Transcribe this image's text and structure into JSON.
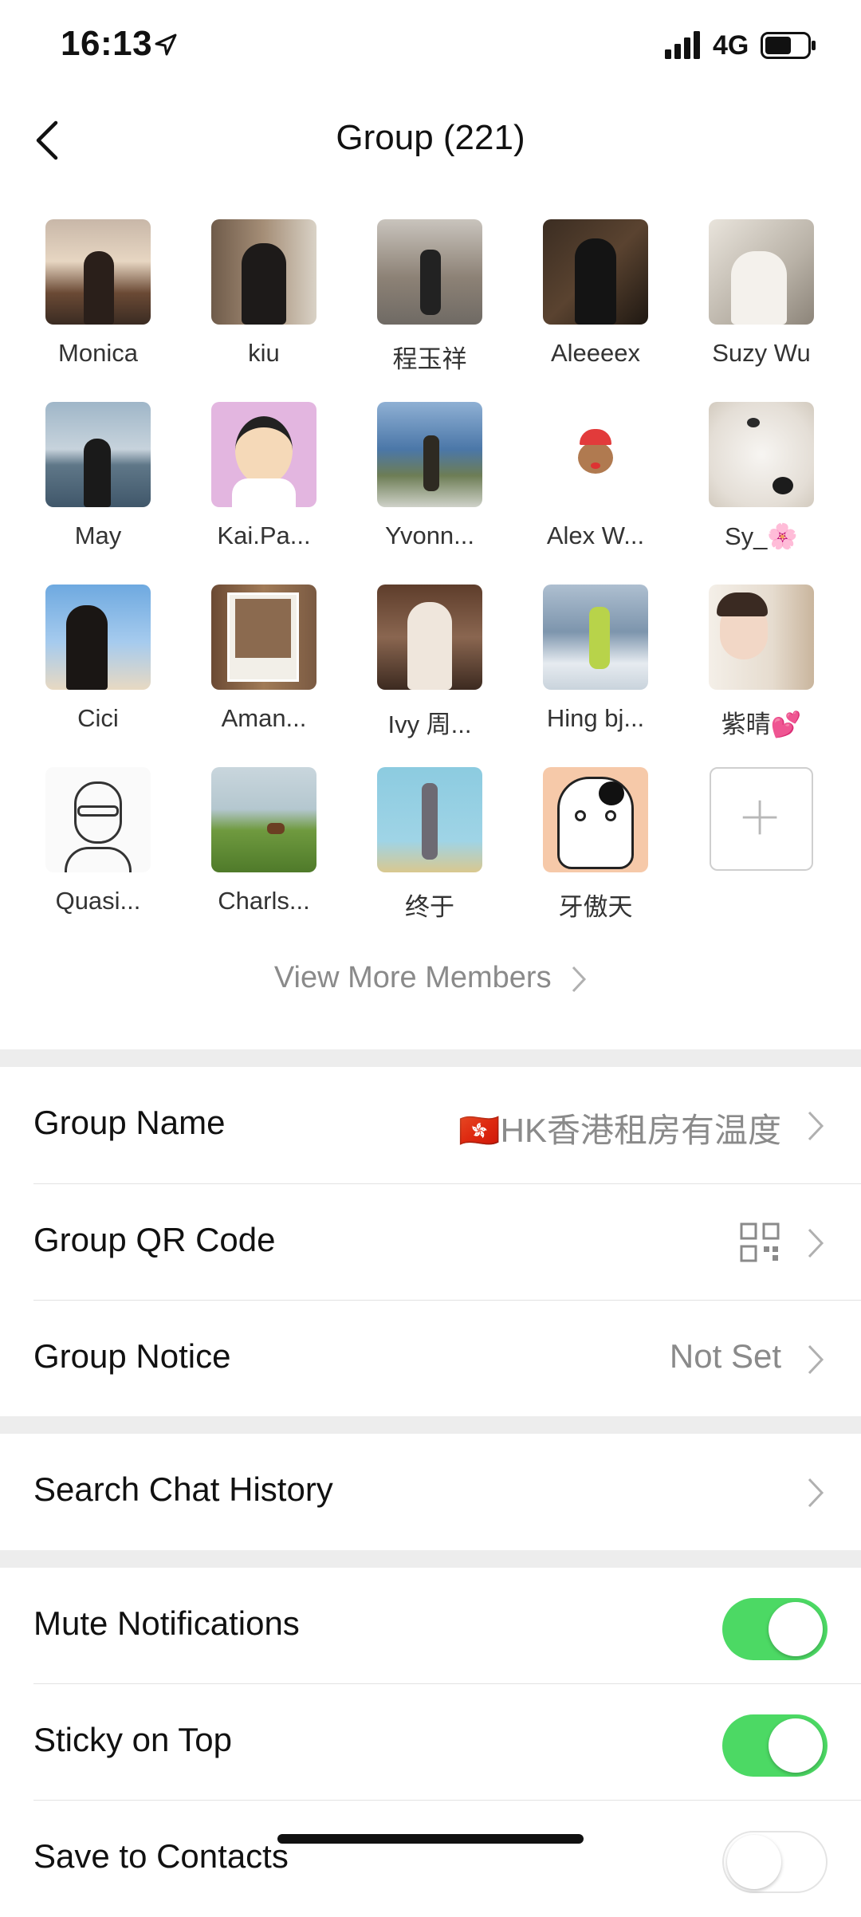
{
  "status": {
    "time": "16:13",
    "network": "4G"
  },
  "nav": {
    "title": "Group (221)"
  },
  "members": [
    {
      "name": "Monica"
    },
    {
      "name": "kiu"
    },
    {
      "name": "程玉祥"
    },
    {
      "name": "Aleeeex"
    },
    {
      "name": "Suzy Wu"
    },
    {
      "name": "May"
    },
    {
      "name": "Kai.Pa..."
    },
    {
      "name": "Yvonn..."
    },
    {
      "name": "Alex W..."
    },
    {
      "name": "Sy_🌸"
    },
    {
      "name": "Cici"
    },
    {
      "name": "Aman..."
    },
    {
      "name": "Ivy 周..."
    },
    {
      "name": "Hing bj..."
    },
    {
      "name": "紫晴💕"
    },
    {
      "name": "Quasi..."
    },
    {
      "name": "Charls..."
    },
    {
      "name": "终于"
    },
    {
      "name": "牙傲天"
    }
  ],
  "view_more": "View More Members",
  "settings": {
    "group_name": {
      "label": "Group Name",
      "value": "🇭🇰HK香港租房有温度"
    },
    "group_qr": {
      "label": "Group QR Code"
    },
    "group_notice": {
      "label": "Group Notice",
      "value": "Not Set"
    },
    "search_history": {
      "label": "Search Chat History"
    },
    "mute": {
      "label": "Mute Notifications",
      "on": true
    },
    "sticky": {
      "label": "Sticky on Top",
      "on": true
    },
    "save_contacts": {
      "label": "Save to Contacts",
      "on": false
    }
  },
  "colors": {
    "toggle_on": "#4cd964",
    "separator": "#ededed"
  }
}
